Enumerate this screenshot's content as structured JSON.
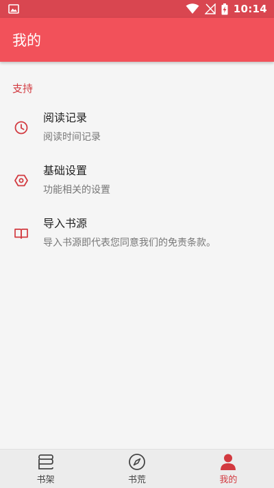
{
  "status_bar": {
    "time": "10:14"
  },
  "app_bar": {
    "title": "我的"
  },
  "section": {
    "title": "支持"
  },
  "items": [
    {
      "title": "阅读记录",
      "subtitle": "阅读时间记录",
      "icon": "clock-icon"
    },
    {
      "title": "基础设置",
      "subtitle": "功能相关的设置",
      "icon": "settings-hexagon-icon"
    },
    {
      "title": "导入书源",
      "subtitle": "导入书源即代表您同意我们的免责条款。",
      "icon": "open-book-icon"
    }
  ],
  "bottom_nav": [
    {
      "label": "书架",
      "icon": "bookshelf-icon",
      "active": false
    },
    {
      "label": "书荒",
      "icon": "compass-icon",
      "active": false
    },
    {
      "label": "我的",
      "icon": "person-icon",
      "active": true
    }
  ],
  "colors": {
    "accent": "#d2393f",
    "app_bar": "#f2515a",
    "status_bar": "#d94650"
  }
}
